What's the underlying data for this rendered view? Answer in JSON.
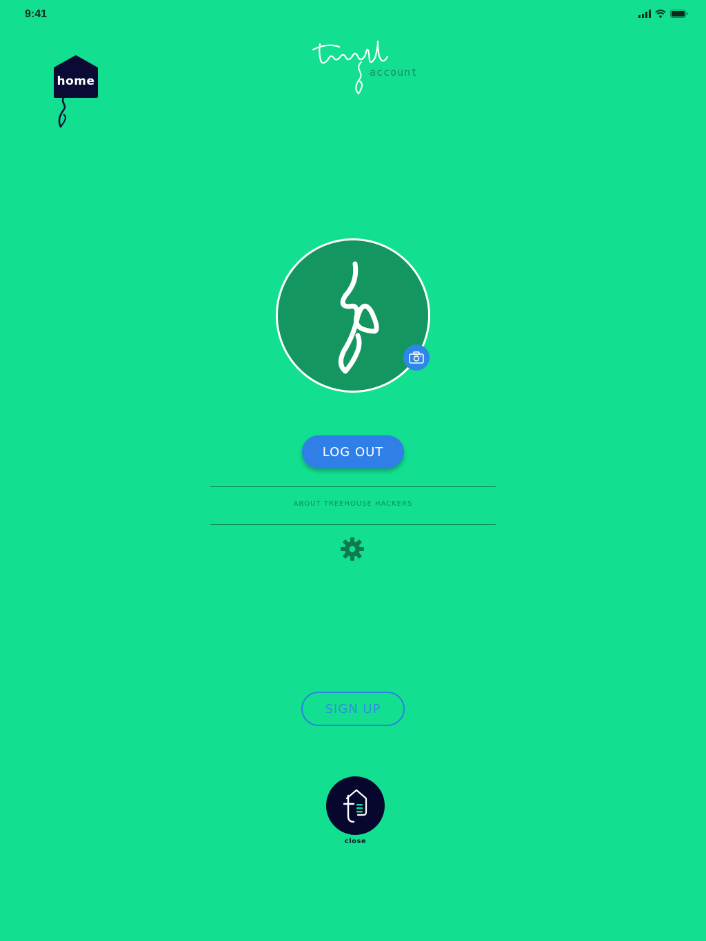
{
  "status_bar": {
    "time": "9:41"
  },
  "header": {
    "home_label": "home",
    "logo_text": "treeple",
    "logo_subtitle": "account"
  },
  "profile": {
    "avatar_icon": "sprout-icon",
    "camera_icon": "camera-icon"
  },
  "actions": {
    "logout_label": "LOG OUT",
    "about_label": "ABOUT TREEHOUSE HACKERS",
    "settings_icon": "gear-icon",
    "signup_label": "SIGN UP",
    "close_label": "close"
  },
  "colors": {
    "background": "#12df8f",
    "primary_blue": "#2f7fe6",
    "dark_navy": "#07072e",
    "avatar_green": "#13965f"
  }
}
